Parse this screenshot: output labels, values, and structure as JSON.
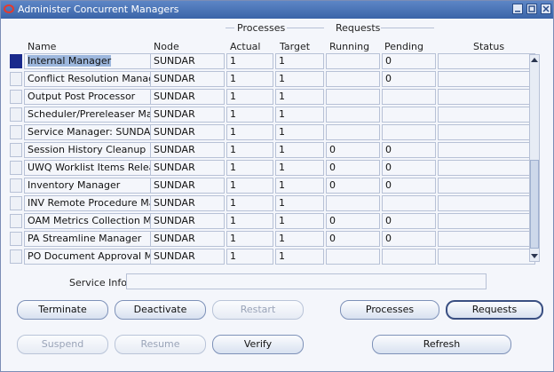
{
  "window": {
    "title": "Administer Concurrent Managers"
  },
  "sections": {
    "processes": "Processes",
    "requests": "Requests"
  },
  "columns": {
    "name": "Name",
    "node": "Node",
    "actual": "Actual",
    "target": "Target",
    "running": "Running",
    "pending": "Pending",
    "status": "Status"
  },
  "rows": [
    {
      "name": "Internal Manager",
      "node": "SUNDAR",
      "actual": "1",
      "target": "1",
      "running": "",
      "pending": "0",
      "status": ""
    },
    {
      "name": "Conflict Resolution Manager",
      "node": "SUNDAR",
      "actual": "1",
      "target": "1",
      "running": "",
      "pending": "0",
      "status": ""
    },
    {
      "name": "Output Post Processor",
      "node": "SUNDAR",
      "actual": "1",
      "target": "1",
      "running": "",
      "pending": "",
      "status": ""
    },
    {
      "name": "Scheduler/Prereleaser Manag",
      "node": "SUNDAR",
      "actual": "1",
      "target": "1",
      "running": "",
      "pending": "",
      "status": ""
    },
    {
      "name": "Service Manager: SUNDAR",
      "node": "SUNDAR",
      "actual": "1",
      "target": "1",
      "running": "",
      "pending": "",
      "status": ""
    },
    {
      "name": "Session History Cleanup",
      "node": "SUNDAR",
      "actual": "1",
      "target": "1",
      "running": "0",
      "pending": "0",
      "status": ""
    },
    {
      "name": "UWQ Worklist Items Release",
      "node": "SUNDAR",
      "actual": "1",
      "target": "1",
      "running": "0",
      "pending": "0",
      "status": ""
    },
    {
      "name": "Inventory Manager",
      "node": "SUNDAR",
      "actual": "1",
      "target": "1",
      "running": "0",
      "pending": "0",
      "status": ""
    },
    {
      "name": "INV Remote Procedure Mana",
      "node": "SUNDAR",
      "actual": "1",
      "target": "1",
      "running": "",
      "pending": "",
      "status": ""
    },
    {
      "name": "OAM Metrics Collection Man",
      "node": "SUNDAR",
      "actual": "1",
      "target": "1",
      "running": "0",
      "pending": "0",
      "status": ""
    },
    {
      "name": "PA Streamline Manager",
      "node": "SUNDAR",
      "actual": "1",
      "target": "1",
      "running": "0",
      "pending": "0",
      "status": ""
    },
    {
      "name": "PO Document Approval Mana",
      "node": "SUNDAR",
      "actual": "1",
      "target": "1",
      "running": "",
      "pending": "",
      "status": ""
    }
  ],
  "service_info": {
    "label": "Service Info",
    "value": ""
  },
  "buttons": {
    "terminate": "Terminate",
    "deactivate": "Deactivate",
    "restart": "Restart",
    "processes": "Processes",
    "requests": "Requests",
    "suspend": "Suspend",
    "resume": "Resume",
    "verify": "Verify",
    "refresh": "Refresh"
  }
}
